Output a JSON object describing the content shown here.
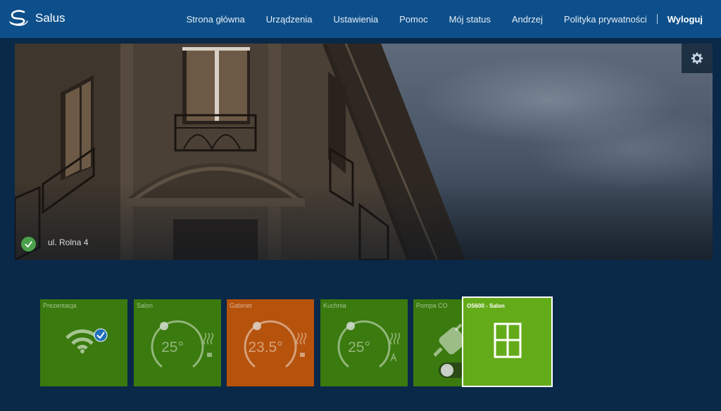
{
  "brand": {
    "name": "Salus"
  },
  "nav": {
    "items": [
      "Strona główna",
      "Urządzenia",
      "Ustawienia",
      "Pomoc",
      "Mój status",
      "Andrzej",
      "Polityka prywatności"
    ],
    "logout": "Wyloguj"
  },
  "hero": {
    "address": "ul. Rolna 4",
    "status": "online",
    "settings_icon": "gear-icon",
    "status_icon": "check-icon"
  },
  "tiles": [
    {
      "name": "Prezentacja",
      "icon": "wifi-icon",
      "badge_icon": "check-icon",
      "color": "#3a7a0e"
    },
    {
      "name": "Salon",
      "temperature": "25°",
      "icon": "heating-icon",
      "color": "#3a7a0e"
    },
    {
      "name": "Gabinet",
      "temperature": "23.5°",
      "icon": "heating-icon",
      "color": "#b5520c"
    },
    {
      "name": "Kuchnia",
      "temperature": "25°",
      "icon": "heating-icon",
      "color": "#3a7a0e"
    },
    {
      "name": "Pompa CO",
      "icon": "plug-icon",
      "color": "#3a7a0e"
    },
    {
      "name": "OS600 - Salon",
      "icon": "window-icon",
      "color": "#64ab1a",
      "selected": true
    }
  ],
  "colors": {
    "navbar": "#0d4f8a",
    "background": "#0a2848",
    "tile_green": "#3a7a0e",
    "tile_orange": "#b5520c",
    "tile_selected": "#64ab1a"
  }
}
